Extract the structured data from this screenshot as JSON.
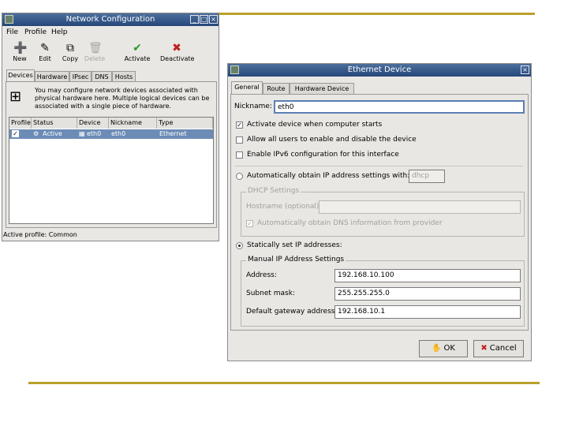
{
  "network_window": {
    "title": "Network Configuration",
    "menu": [
      "File",
      "Profile",
      "Help"
    ],
    "toolbar": [
      {
        "label": "New",
        "icon": "new-icon"
      },
      {
        "label": "Edit",
        "icon": "edit-icon"
      },
      {
        "label": "Copy",
        "icon": "copy-icon"
      },
      {
        "label": "Delete",
        "icon": "delete-icon"
      },
      {
        "label": "Activate",
        "icon": "check-icon"
      },
      {
        "label": "Deactivate",
        "icon": "x-icon"
      }
    ],
    "tabs": [
      "Devices",
      "Hardware",
      "IPsec",
      "DNS",
      "Hosts"
    ],
    "info_text": "You may configure network devices associated with physical hardware here.  Multiple logical devices can be associated with a single piece of hardware.",
    "columns": [
      "Profile",
      "Status",
      "Device",
      "Nickname",
      "Type"
    ],
    "rows": [
      {
        "profile": "✓",
        "status": "Active",
        "device": "eth0",
        "nickname": "eth0",
        "type": "Ethernet"
      }
    ],
    "status_bar": "Active profile: Common"
  },
  "ethernet_dialog": {
    "title": "Ethernet Device",
    "tabs": [
      "General",
      "Route",
      "Hardware Device"
    ],
    "nickname_label": "Nickname:",
    "nickname_value": "eth0",
    "activate_on_start": "Activate device when computer starts",
    "allow_users": "Allow all users to enable and disable the device",
    "enable_ipv6": "Enable IPv6 configuration for this interface",
    "auto_obtain": "Automatically obtain IP address settings with:",
    "auto_method": "dhcp",
    "dhcp_group": "DHCP Settings",
    "hostname_label": "Hostname (optional):",
    "auto_dns": "Automatically obtain DNS information from provider",
    "static_set": "Statically set IP addresses:",
    "manual_group": "Manual IP Address Settings",
    "address_label": "Address:",
    "address_value": "192.168.10.100",
    "subnet_label": "Subnet mask:",
    "subnet_value": "255.255.255.0",
    "gateway_label": "Default gateway address:",
    "gateway_value": "192.168.10.1",
    "ok_label": "OK",
    "cancel_label": "Cancel"
  },
  "colors": {
    "rule": "#b8a02a",
    "titlebar": "#24467a",
    "selection": "#6c8cb6"
  }
}
